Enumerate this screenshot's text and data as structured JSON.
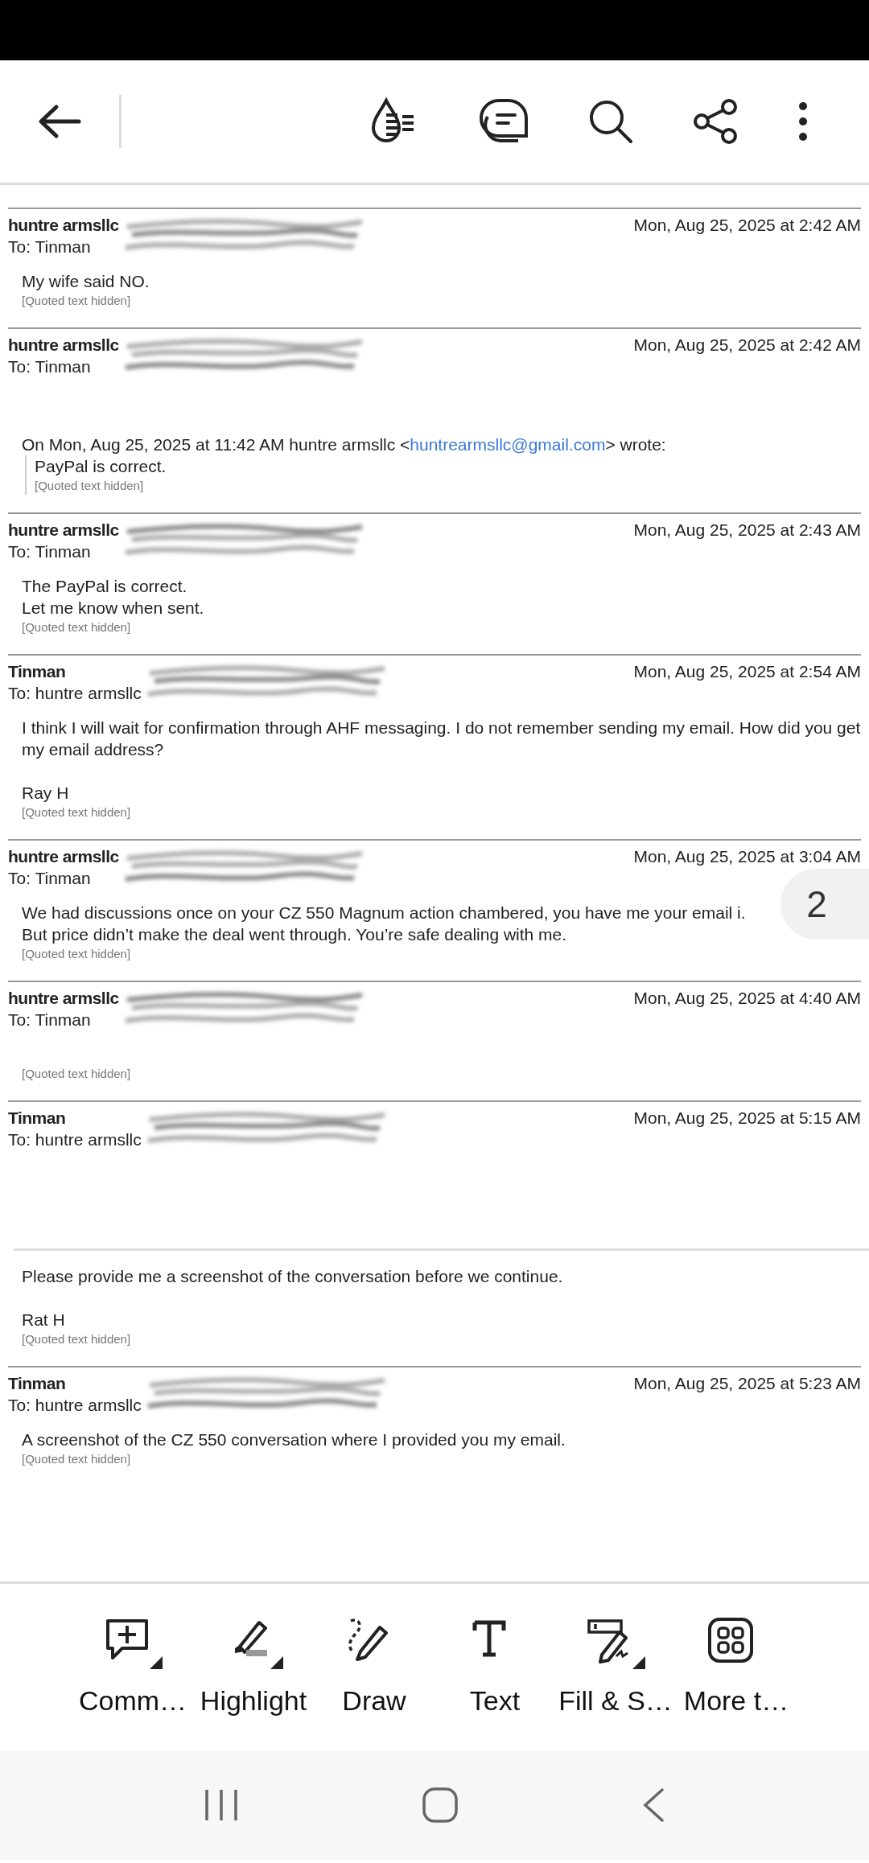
{
  "emails": [
    {
      "sender": "huntre armsllc",
      "date": "Mon, Aug 25, 2025 at 2:42 AM",
      "to": "To: Tinman",
      "blocks": [
        {
          "kind": "text",
          "lines": [
            "My wife said NO."
          ]
        },
        {
          "kind": "hidden",
          "text": "[Quoted text hidden]"
        }
      ]
    },
    {
      "sender": "huntre armsllc",
      "date": "Mon, Aug 25, 2025 at 2:42 AM",
      "to": "To: Tinman",
      "blocks": [
        {
          "kind": "blank"
        },
        {
          "kind": "blank"
        },
        {
          "kind": "intro",
          "before": "On Mon, Aug 25, 2025 at 11:42 AM huntre armsllc <",
          "link": "huntrearmsllc@gmail.com",
          "after": "> wrote:"
        },
        {
          "kind": "quote",
          "lines": [
            "PayPal is correct."
          ],
          "hidden": "[Quoted text hidden]"
        }
      ]
    },
    {
      "sender": "huntre armsllc",
      "date": "Mon, Aug 25, 2025 at 2:43 AM",
      "to": "To: Tinman",
      "blocks": [
        {
          "kind": "text",
          "lines": [
            "The PayPal is correct.",
            "Let me know when sent."
          ]
        },
        {
          "kind": "hidden",
          "text": "[Quoted text hidden]"
        }
      ]
    },
    {
      "sender": "Tinman",
      "date": "Mon, Aug 25, 2025 at 2:54 AM",
      "to": "To: huntre armsllc",
      "blocks": [
        {
          "kind": "text",
          "lines": [
            "I think I will wait for confirmation through AHF messaging. I do not remember sending my email.  How did you get my email address?"
          ]
        },
        {
          "kind": "blank"
        },
        {
          "kind": "text",
          "lines": [
            "Ray H"
          ]
        },
        {
          "kind": "hidden",
          "text": "[Quoted text hidden]"
        }
      ]
    },
    {
      "sender": "huntre armsllc",
      "date": "Mon, Aug 25, 2025 at 3:04 AM",
      "to": "To: Tinman",
      "blocks": [
        {
          "kind": "text",
          "lines": [
            "We had discussions once on your  CZ 550 Magnum action chambered, you have me your email i.",
            "But price didn’t make the deal went through. You’re safe dealing with me."
          ]
        },
        {
          "kind": "hidden",
          "text": "[Quoted text hidden]"
        }
      ]
    },
    {
      "sender": "huntre armsllc",
      "date": "Mon, Aug 25, 2025 at 4:40 AM",
      "to": "To: Tinman",
      "blocks": [
        {
          "kind": "blank"
        },
        {
          "kind": "hidden",
          "text": "[Quoted text hidden]"
        }
      ]
    },
    {
      "sender": "Tinman",
      "date": "Mon, Aug 25, 2025 at 5:15 AM",
      "to": "To: huntre armsllc",
      "blocks": [
        {
          "kind": "page_break"
        },
        {
          "kind": "text",
          "lines": [
            "Please provide me a screenshot of the conversation before we continue."
          ]
        },
        {
          "kind": "blank"
        },
        {
          "kind": "text",
          "lines": [
            "Rat H"
          ]
        },
        {
          "kind": "hidden",
          "text": "[Quoted text hidden]"
        }
      ]
    },
    {
      "sender": "Tinman",
      "date": "Mon, Aug 25, 2025 at 5:23 AM",
      "to": "To: huntre armsllc",
      "blocks": [
        {
          "kind": "text",
          "lines": [
            "A screenshot of the CZ 550 conversation where I provided you my email."
          ]
        },
        {
          "kind": "hidden",
          "text": "[Quoted text hidden]"
        }
      ]
    }
  ],
  "page_indicator": "2",
  "tools": [
    {
      "label": "Comm…",
      "has_menu": true
    },
    {
      "label": "Highlight",
      "has_menu": true
    },
    {
      "label": "Draw",
      "has_menu": false
    },
    {
      "label": "Text",
      "has_menu": false
    },
    {
      "label": "Fill & S…",
      "has_menu": true
    },
    {
      "label": "More t…",
      "has_menu": false
    }
  ]
}
